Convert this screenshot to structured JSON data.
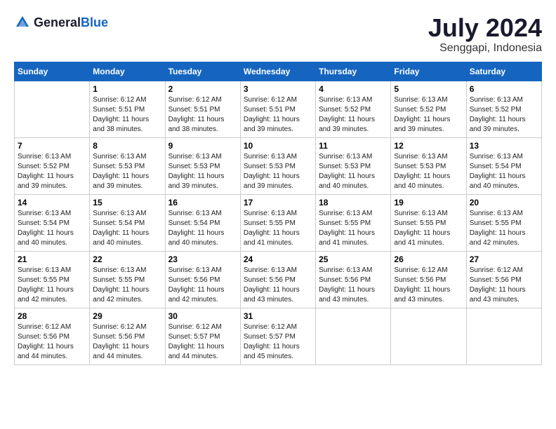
{
  "header": {
    "logo_general": "General",
    "logo_blue": "Blue",
    "month": "July 2024",
    "location": "Senggapi, Indonesia"
  },
  "weekdays": [
    "Sunday",
    "Monday",
    "Tuesday",
    "Wednesday",
    "Thursday",
    "Friday",
    "Saturday"
  ],
  "weeks": [
    [
      {
        "day": "",
        "content": ""
      },
      {
        "day": "1",
        "content": "Sunrise: 6:12 AM\nSunset: 5:51 PM\nDaylight: 11 hours\nand 38 minutes."
      },
      {
        "day": "2",
        "content": "Sunrise: 6:12 AM\nSunset: 5:51 PM\nDaylight: 11 hours\nand 38 minutes."
      },
      {
        "day": "3",
        "content": "Sunrise: 6:12 AM\nSunset: 5:51 PM\nDaylight: 11 hours\nand 39 minutes."
      },
      {
        "day": "4",
        "content": "Sunrise: 6:13 AM\nSunset: 5:52 PM\nDaylight: 11 hours\nand 39 minutes."
      },
      {
        "day": "5",
        "content": "Sunrise: 6:13 AM\nSunset: 5:52 PM\nDaylight: 11 hours\nand 39 minutes."
      },
      {
        "day": "6",
        "content": "Sunrise: 6:13 AM\nSunset: 5:52 PM\nDaylight: 11 hours\nand 39 minutes."
      }
    ],
    [
      {
        "day": "7",
        "content": "Sunrise: 6:13 AM\nSunset: 5:52 PM\nDaylight: 11 hours\nand 39 minutes."
      },
      {
        "day": "8",
        "content": "Sunrise: 6:13 AM\nSunset: 5:53 PM\nDaylight: 11 hours\nand 39 minutes."
      },
      {
        "day": "9",
        "content": "Sunrise: 6:13 AM\nSunset: 5:53 PM\nDaylight: 11 hours\nand 39 minutes."
      },
      {
        "day": "10",
        "content": "Sunrise: 6:13 AM\nSunset: 5:53 PM\nDaylight: 11 hours\nand 39 minutes."
      },
      {
        "day": "11",
        "content": "Sunrise: 6:13 AM\nSunset: 5:53 PM\nDaylight: 11 hours\nand 40 minutes."
      },
      {
        "day": "12",
        "content": "Sunrise: 6:13 AM\nSunset: 5:53 PM\nDaylight: 11 hours\nand 40 minutes."
      },
      {
        "day": "13",
        "content": "Sunrise: 6:13 AM\nSunset: 5:54 PM\nDaylight: 11 hours\nand 40 minutes."
      }
    ],
    [
      {
        "day": "14",
        "content": "Sunrise: 6:13 AM\nSunset: 5:54 PM\nDaylight: 11 hours\nand 40 minutes."
      },
      {
        "day": "15",
        "content": "Sunrise: 6:13 AM\nSunset: 5:54 PM\nDaylight: 11 hours\nand 40 minutes."
      },
      {
        "day": "16",
        "content": "Sunrise: 6:13 AM\nSunset: 5:54 PM\nDaylight: 11 hours\nand 40 minutes."
      },
      {
        "day": "17",
        "content": "Sunrise: 6:13 AM\nSunset: 5:55 PM\nDaylight: 11 hours\nand 41 minutes."
      },
      {
        "day": "18",
        "content": "Sunrise: 6:13 AM\nSunset: 5:55 PM\nDaylight: 11 hours\nand 41 minutes."
      },
      {
        "day": "19",
        "content": "Sunrise: 6:13 AM\nSunset: 5:55 PM\nDaylight: 11 hours\nand 41 minutes."
      },
      {
        "day": "20",
        "content": "Sunrise: 6:13 AM\nSunset: 5:55 PM\nDaylight: 11 hours\nand 42 minutes."
      }
    ],
    [
      {
        "day": "21",
        "content": "Sunrise: 6:13 AM\nSunset: 5:55 PM\nDaylight: 11 hours\nand 42 minutes."
      },
      {
        "day": "22",
        "content": "Sunrise: 6:13 AM\nSunset: 5:55 PM\nDaylight: 11 hours\nand 42 minutes."
      },
      {
        "day": "23",
        "content": "Sunrise: 6:13 AM\nSunset: 5:56 PM\nDaylight: 11 hours\nand 42 minutes."
      },
      {
        "day": "24",
        "content": "Sunrise: 6:13 AM\nSunset: 5:56 PM\nDaylight: 11 hours\nand 43 minutes."
      },
      {
        "day": "25",
        "content": "Sunrise: 6:13 AM\nSunset: 5:56 PM\nDaylight: 11 hours\nand 43 minutes."
      },
      {
        "day": "26",
        "content": "Sunrise: 6:12 AM\nSunset: 5:56 PM\nDaylight: 11 hours\nand 43 minutes."
      },
      {
        "day": "27",
        "content": "Sunrise: 6:12 AM\nSunset: 5:56 PM\nDaylight: 11 hours\nand 43 minutes."
      }
    ],
    [
      {
        "day": "28",
        "content": "Sunrise: 6:12 AM\nSunset: 5:56 PM\nDaylight: 11 hours\nand 44 minutes."
      },
      {
        "day": "29",
        "content": "Sunrise: 6:12 AM\nSunset: 5:56 PM\nDaylight: 11 hours\nand 44 minutes."
      },
      {
        "day": "30",
        "content": "Sunrise: 6:12 AM\nSunset: 5:57 PM\nDaylight: 11 hours\nand 44 minutes."
      },
      {
        "day": "31",
        "content": "Sunrise: 6:12 AM\nSunset: 5:57 PM\nDaylight: 11 hours\nand 45 minutes."
      },
      {
        "day": "",
        "content": ""
      },
      {
        "day": "",
        "content": ""
      },
      {
        "day": "",
        "content": ""
      }
    ]
  ]
}
